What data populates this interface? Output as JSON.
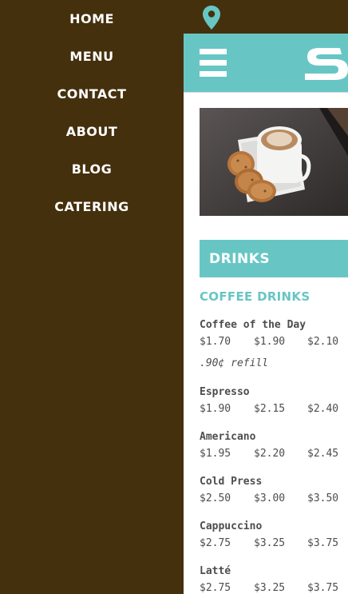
{
  "nav": {
    "items": [
      {
        "label": "HOME"
      },
      {
        "label": "MENU"
      },
      {
        "label": "CONTACT"
      },
      {
        "label": "ABOUT"
      },
      {
        "label": "BLOG"
      },
      {
        "label": "CATERING"
      }
    ]
  },
  "icons": {
    "location": "map-pin-icon",
    "menu": "hamburger-icon"
  },
  "header": {
    "logo_fragment": "S"
  },
  "colors": {
    "sidebar": "#45300d",
    "accent": "#67c6c4",
    "text": "#4d4d4d"
  },
  "section": {
    "title": "DRINKS",
    "subtitle": "COFFEE DRINKS"
  },
  "menu_items": [
    {
      "name": "Coffee of the Day",
      "prices": [
        "$1.70",
        "$1.90",
        "$2.10"
      ],
      "note": ".90¢ refill"
    },
    {
      "name": "Espresso",
      "prices": [
        "$1.90",
        "$2.15",
        "$2.40"
      ]
    },
    {
      "name": "Americano",
      "prices": [
        "$1.95",
        "$2.20",
        "$2.45"
      ]
    },
    {
      "name": "Cold Press",
      "prices": [
        "$2.50",
        "$3.00",
        "$3.50"
      ]
    },
    {
      "name": "Cappuccino",
      "prices": [
        "$2.75",
        "$3.25",
        "$3.75"
      ]
    },
    {
      "name": "Latté",
      "prices": [
        "$2.75",
        "$3.25",
        "$3.75"
      ]
    }
  ]
}
